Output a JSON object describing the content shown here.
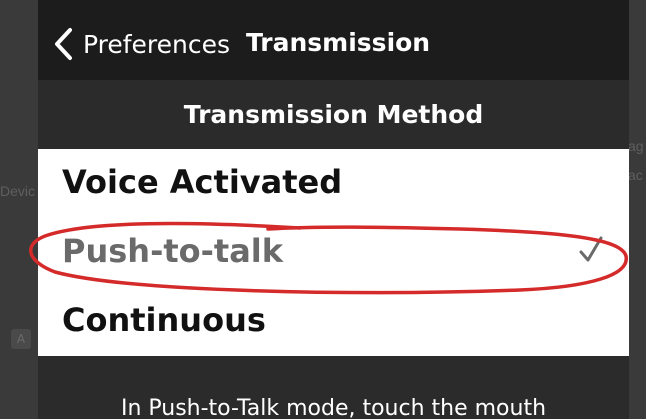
{
  "background": {
    "left_text": "Devic",
    "right_text_1": "ag",
    "right_text_2": "ac",
    "left_icon": "A"
  },
  "nav": {
    "back_label": "Preferences",
    "title": "Transmission"
  },
  "section": {
    "header": "Transmission Method"
  },
  "options": [
    {
      "label": "Voice Activated",
      "selected": false
    },
    {
      "label": "Push-to-talk",
      "selected": true
    },
    {
      "label": "Continuous",
      "selected": false
    }
  ],
  "footer": {
    "text": "In Push-to-Talk mode, touch the mouth"
  },
  "colors": {
    "nav_bg": "#1c1c1c",
    "panel_bg": "#2b2b2b",
    "annotation_red": "#d42a2a"
  }
}
